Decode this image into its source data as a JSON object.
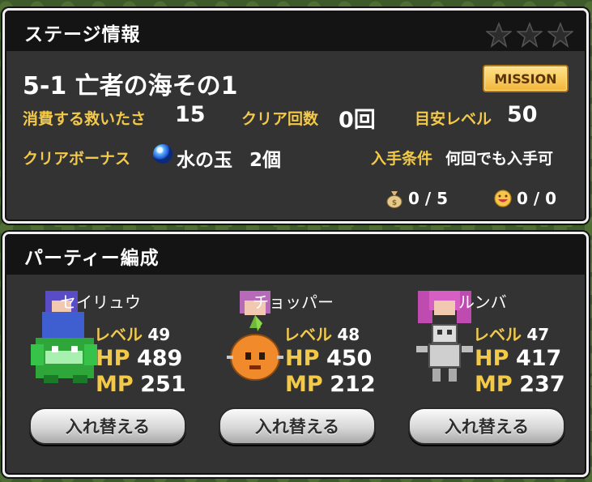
{
  "stage_panel": {
    "title": "ステージ情報",
    "stars": 3,
    "stage_name": "5-1 亡者の海その1",
    "mission_label": "MISSION",
    "cost_label": "消費する救いたさ",
    "cost_value": "15",
    "clear_count_label": "クリア回数",
    "clear_count_value": "0回",
    "level_guide_label": "目安レベル",
    "level_guide_value": "50",
    "bonus_label": "クリアボーナス",
    "bonus_item": "水の玉",
    "bonus_count": "2個",
    "condition_label": "入手条件",
    "condition_value": "何回でも入手可",
    "bag_counter": "0 / 5",
    "smile_counter": "0 / 0"
  },
  "party_panel": {
    "title": "パーティー編成",
    "level_label": "レベル",
    "hp_label": "HP",
    "mp_label": "MP",
    "swap_label": "入れ替える",
    "members": [
      {
        "name": "セイリュウ",
        "level": "49",
        "hp": "489",
        "mp": "251"
      },
      {
        "name": "チョッパー",
        "level": "48",
        "hp": "450",
        "mp": "212"
      },
      {
        "name": "ルンバ",
        "level": "47",
        "hp": "417",
        "mp": "237"
      }
    ]
  },
  "colors": {
    "label_gold": "#f3c94a",
    "panel_bg": "#333333",
    "header_bg": "#141414",
    "mission_gold": "#f2b63a"
  }
}
